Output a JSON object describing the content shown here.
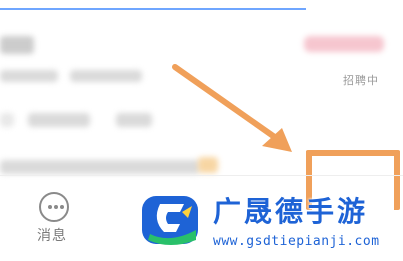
{
  "job_card": {
    "status": "招聘中"
  },
  "tabbar": {
    "messages_label": "消息"
  },
  "watermark": {
    "site_name": "广晟德手游",
    "url": "www.gsdtiepianji.com"
  },
  "colors": {
    "annotation": "#f0a05a",
    "brand": "#1e63d6",
    "top_bar": "#6fa6ff"
  },
  "icons": [
    "message-icon",
    "arrow-annotation",
    "site-logo-icon"
  ]
}
